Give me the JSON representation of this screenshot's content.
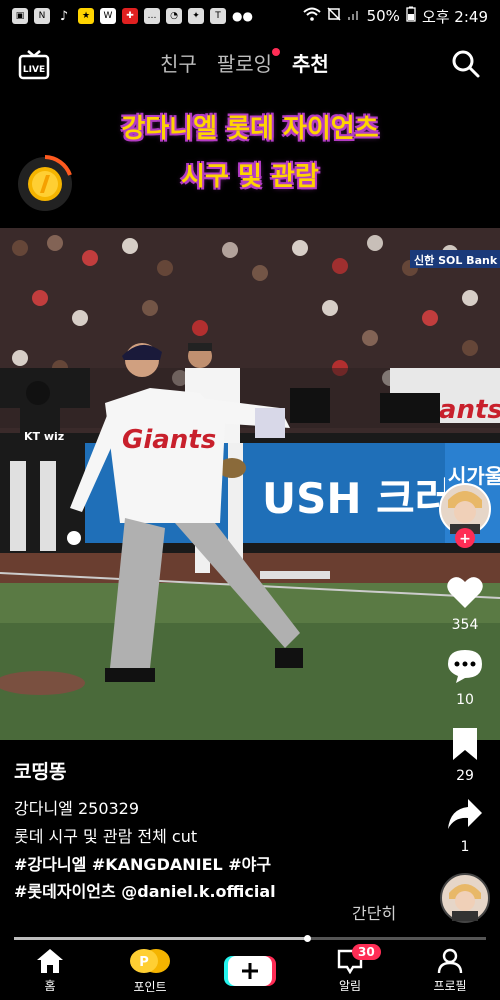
{
  "status_bar": {
    "battery": "50%",
    "time": "오후 2:49",
    "left_icons": [
      "gallery-icon",
      "n-icon",
      "tiktok-icon",
      "kakao-bank-icon",
      "won-icon",
      "toss-icon",
      "chat-icon",
      "chat-icon",
      "star-icon",
      "talk-icon",
      "more-dots-icon"
    ]
  },
  "topnav": {
    "tabs": [
      {
        "label": "친구"
      },
      {
        "label": "팔로잉"
      },
      {
        "label": "추천"
      }
    ]
  },
  "overlay": {
    "line1": "강다니엘 롯데 자이언츠",
    "line2": "시구 및 관람"
  },
  "scene_text": {
    "jersey": "Giants",
    "board1": "USH 크러시",
    "board2": "시가울",
    "sponsor": "신한 SOL Bank K",
    "kt": "KT wiz",
    "banner": "iants"
  },
  "actions": {
    "likes": "354",
    "comments": "10",
    "saves": "29",
    "shares": "1"
  },
  "post": {
    "author": "코띵똥",
    "line1": "강다니엘 250329",
    "line2": "롯데 시구 및 관람 전체 cut",
    "line3": "#강다니엘 #KANGDANIEL #야구",
    "line4": "#롯데자이언츠 @daniel.k.official",
    "more": "간단히",
    "progress": 0.62
  },
  "bottom_nav": {
    "home": "홈",
    "points": "포인트",
    "alerts": "알림",
    "alerts_badge": "30",
    "profile": "프로필"
  },
  "colors": {
    "accent": "#ff2d55",
    "caption_yellow": "#ffd400",
    "caption_outline": "#b33cc4"
  }
}
